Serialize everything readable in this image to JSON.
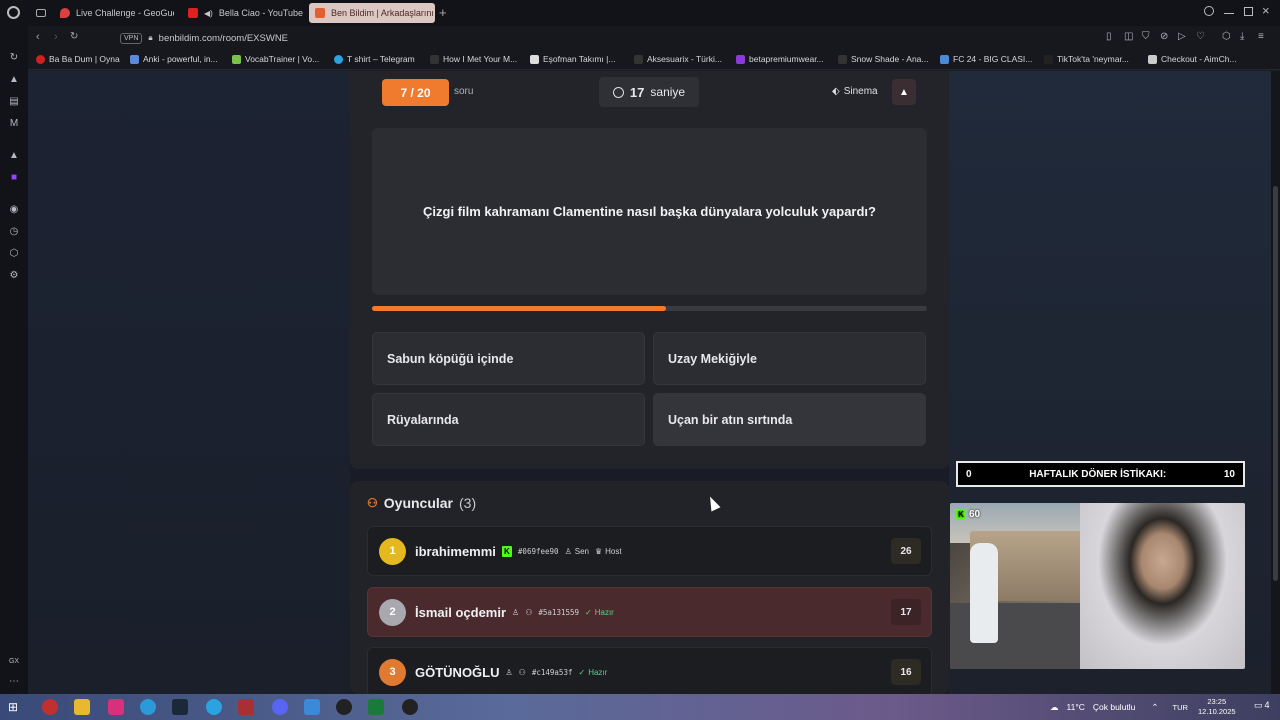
{
  "browser": {
    "tabs": [
      {
        "label": "Live Challenge - GeoGuess",
        "color": "#d94040"
      },
      {
        "label": "Bella Ciao - YouTube",
        "color": "#e02020"
      },
      {
        "label": "Ben Bildim | Arkadaşlarını",
        "color": "#e06030",
        "active": true
      }
    ],
    "url": "benbildim.com/room/EXSWNE",
    "vpn": "VPN",
    "bookmarks": [
      {
        "label": "Ba Ba Dum | Oyna",
        "color": "#d02020"
      },
      {
        "label": "Anki - powerful, in...",
        "color": "#5a8ad8"
      },
      {
        "label": "VocabTrainer | Vo...",
        "color": "#7cc24a"
      },
      {
        "label": "T shirt – Telegram",
        "color": "#2aa3e0"
      },
      {
        "label": "How I Met Your M...",
        "color": "#333"
      },
      {
        "label": "Eşofman Takımı |...",
        "color": "#ddd"
      },
      {
        "label": "Aksesuarix - Türki...",
        "color": "#333"
      },
      {
        "label": "betapremiumwear...",
        "color": "#8a3ad8"
      },
      {
        "label": "Snow Shade - Ana...",
        "color": "#333"
      },
      {
        "label": "FC 24 - BIG CLASI...",
        "color": "#4a8ad8"
      },
      {
        "label": "TikTok'ta 'neymar...",
        "color": "#222"
      },
      {
        "label": "Checkout - AimCh...",
        "color": "#ccc"
      }
    ]
  },
  "game": {
    "counter": "7 / 20",
    "counter_suffix": "soru",
    "timer_value": "17",
    "timer_unit": "saniye",
    "category": "Sinema",
    "question": "Çizgi film kahramanı Clamentine nasıl başka dünyalara yolculuk yapardı?",
    "progress_fraction": 0.53,
    "answers": [
      "Sabun köpüğü içinde",
      "Uzay Mekiğiyle",
      "Rüyalarında",
      "Uçan bir atın sırtında"
    ]
  },
  "players": {
    "title": "Oyuncular",
    "count": "(3)",
    "list": [
      {
        "rank": "1",
        "name": "ibrahimemmi",
        "tag": "#069fee90",
        "you": "Sen",
        "role": "Host",
        "score": "26",
        "rank_color": "#e6b820"
      },
      {
        "rank": "2",
        "name": "İsmail oçdemir",
        "tag": "#5a131559",
        "status": "Hazır",
        "score": "17",
        "rank_color": "#a8a8ae"
      },
      {
        "rank": "3",
        "name": "GÖTÜNOĞLU",
        "tag": "#c149a53f",
        "status": "Hazır",
        "score": "16",
        "rank_color": "#e07a30"
      }
    ]
  },
  "overlay": {
    "weekly_left": "0",
    "weekly_label": "HAFTALIK DÖNER İSTİKAKI:",
    "weekly_right": "10",
    "viewers": "60"
  },
  "taskbar": {
    "weather": "11°C",
    "weather_text": "Çok bulutlu",
    "lang": "TUR",
    "time": "23:25",
    "date": "12.10.2025",
    "notifications": "4"
  },
  "sidebar": {
    "gx_label": "GX"
  }
}
